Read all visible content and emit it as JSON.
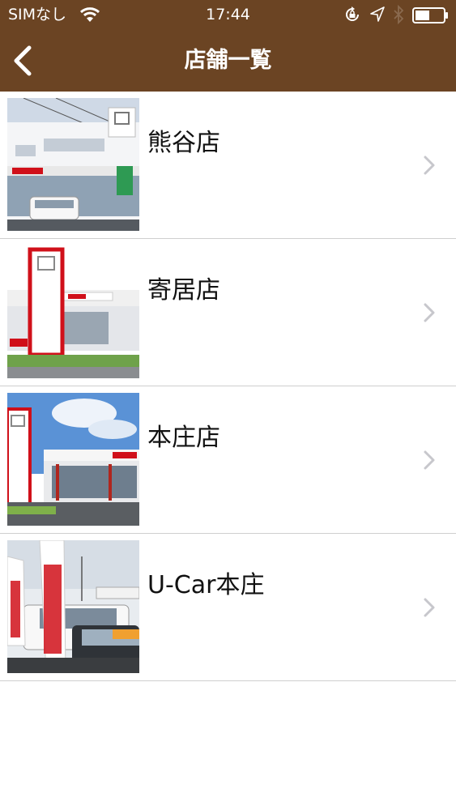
{
  "status_bar": {
    "carrier": "SIMなし",
    "time": "17:44",
    "icons": [
      "wifi-icon",
      "rotation-lock-icon",
      "location-icon",
      "bluetooth-icon",
      "battery-icon"
    ]
  },
  "nav": {
    "title": "店舗一覧",
    "back_icon": "chevron-left-icon"
  },
  "stores": [
    {
      "name": "熊谷店",
      "image": "dealership-photo"
    },
    {
      "name": "寄居店",
      "image": "dealership-photo"
    },
    {
      "name": "本庄店",
      "image": "dealership-photo"
    },
    {
      "name": "U-Car本庄",
      "image": "used-car-lot-photo"
    }
  ],
  "colors": {
    "header_bg": "#6b4423",
    "separator": "#cfcfcf",
    "chevron": "#c7c7cc"
  }
}
